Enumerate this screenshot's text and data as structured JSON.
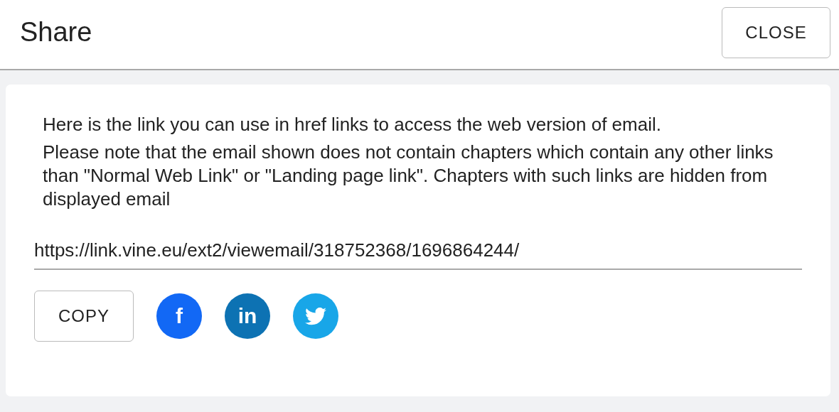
{
  "header": {
    "title": "Share",
    "close_button": "CLOSE"
  },
  "card": {
    "paragraphs": [
      "Here is the link you can use in href links to access the web version of email.",
      "Please note that the email shown does not contain chapters which contain any other links than \"Normal Web Link\" or \"Landing page link\". Chapters with such links are hidden from displayed email"
    ],
    "url_field": {
      "value": "https://link.vine.eu/ext2/viewemail/318752368/1696864244/"
    },
    "copy_button": "COPY",
    "share_buttons": [
      {
        "kind": "facebook",
        "label": "f"
      },
      {
        "kind": "linkedin",
        "label": "in"
      },
      {
        "kind": "twitter"
      }
    ]
  }
}
